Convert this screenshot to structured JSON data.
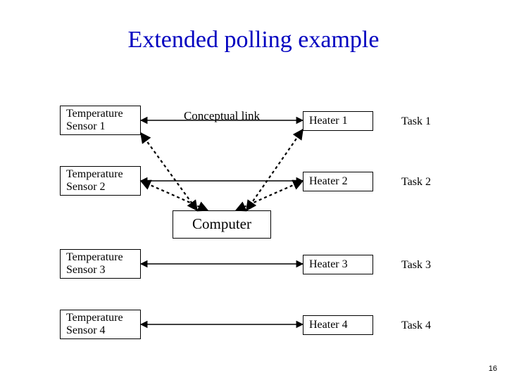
{
  "title": "Extended polling example",
  "conceptual_label": "Conceptual link",
  "computer_label": "Computer",
  "page_number": "16",
  "sensors": [
    {
      "label": "Temperature\nSensor 1"
    },
    {
      "label": "Temperature\nSensor 2"
    },
    {
      "label": "Temperature\nSensor 3"
    },
    {
      "label": "Temperature\nSensor 4"
    }
  ],
  "heaters": [
    {
      "label": "Heater 1"
    },
    {
      "label": "Heater 2"
    },
    {
      "label": "Heater 3"
    },
    {
      "label": "Heater 4"
    }
  ],
  "tasks": [
    {
      "label": "Task 1"
    },
    {
      "label": "Task 2"
    },
    {
      "label": "Task 3"
    },
    {
      "label": "Task 4"
    }
  ]
}
